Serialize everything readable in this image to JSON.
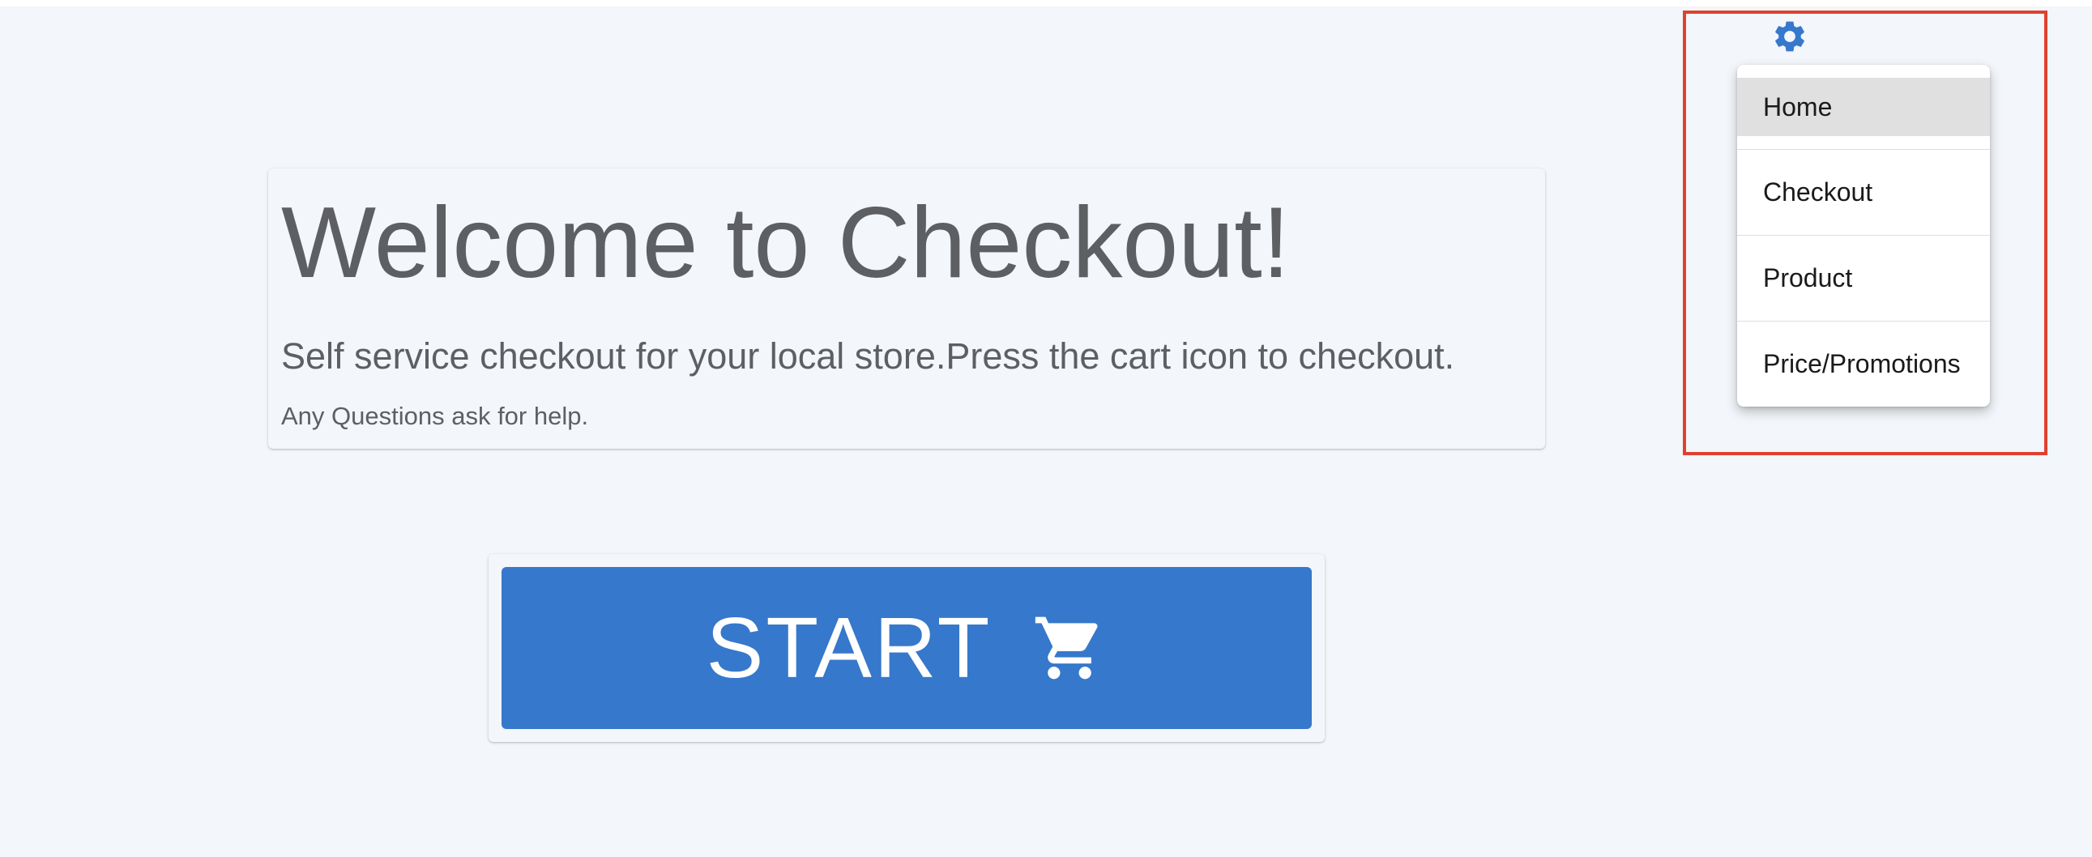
{
  "welcome": {
    "title": "Welcome to Checkout!",
    "subtitle": "Self service checkout for your local store.Press the cart icon to checkout.",
    "help": "Any Questions ask for help."
  },
  "start_button": {
    "label": "START",
    "icon": "cart-icon"
  },
  "settings": {
    "icon": "gear-icon",
    "menu": {
      "items": [
        {
          "label": "Home",
          "active": true
        },
        {
          "label": "Checkout",
          "active": false
        },
        {
          "label": "Product",
          "active": false
        },
        {
          "label": "Price/Promotions",
          "active": false
        }
      ]
    }
  },
  "colors": {
    "accent": "#3678cb",
    "background": "#f3f6fa",
    "text": "#5d5f63",
    "highlight_border": "#e0412f",
    "menu_active": "#e0e0e0"
  }
}
